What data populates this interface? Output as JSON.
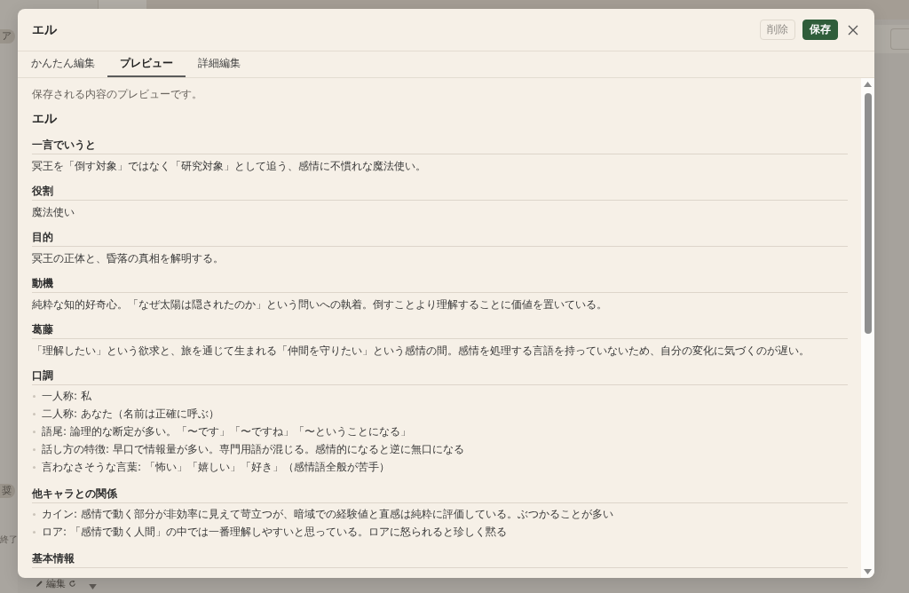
{
  "background": {
    "side_items": [
      {
        "kind": "chip",
        "text": "ア"
      },
      {
        "kind": "chip",
        "text": "奨"
      },
      {
        "kind": "plain",
        "text": "終了"
      }
    ],
    "edit_button": "編集"
  },
  "dialog": {
    "title": "エル",
    "buttons": [
      {
        "label": "削除",
        "kind": "secondary"
      },
      {
        "label": "保存",
        "kind": "primary"
      }
    ],
    "tabs": [
      {
        "label": "かんたん編集",
        "selected": false
      },
      {
        "label": "プレビュー",
        "selected": true
      },
      {
        "label": "詳細編集",
        "selected": false
      }
    ],
    "note": "保存される内容のプレビューです。",
    "preview": {
      "name": "エル",
      "sections": [
        {
          "heading": "一言でいうと",
          "kind": "text",
          "text": "冥王を「倒す対象」ではなく「研究対象」として追う、感情に不慣れな魔法使い。"
        },
        {
          "heading": "役割",
          "kind": "text",
          "text": "魔法使い"
        },
        {
          "heading": "目的",
          "kind": "text",
          "text": "冥王の正体と、昏落の真相を解明する。"
        },
        {
          "heading": "動機",
          "kind": "text",
          "text": "純粋な知的好奇心。「なぜ太陽は隠されたのか」という問いへの執着。倒すことより理解することに価値を置いている。"
        },
        {
          "heading": "葛藤",
          "kind": "text",
          "text": "「理解したい」という欲求と、旅を通じて生まれる「仲間を守りたい」という感情の間。感情を処理する言語を持っていないため、自分の変化に気づくのが遅い。"
        },
        {
          "heading": "口調",
          "kind": "list",
          "items": [
            "一人称: 私",
            "二人称: あなた（名前は正確に呼ぶ）",
            "語尾: 論理的な断定が多い。「〜です」「〜ですね」「〜ということになる」",
            "話し方の特徴: 早口で情報量が多い。専門用語が混じる。感情的になると逆に無口になる",
            "言わなさそうな言葉: 「怖い」「嬉しい」「好き」（感情語全般が苦手）"
          ]
        },
        {
          "heading": "他キャラとの関係",
          "kind": "list",
          "items": [
            "カイン: 感情で動く部分が非効率に見えて苛立つが、暗域での経験値と直感は純粋に評価している。ぶつかることが多い",
            "ロア: 「感情で動く人間」の中では一番理解しやすいと思っている。ロアに怒られると珍しく黙る"
          ]
        },
        {
          "heading": "基本情報"
        }
      ]
    }
  }
}
